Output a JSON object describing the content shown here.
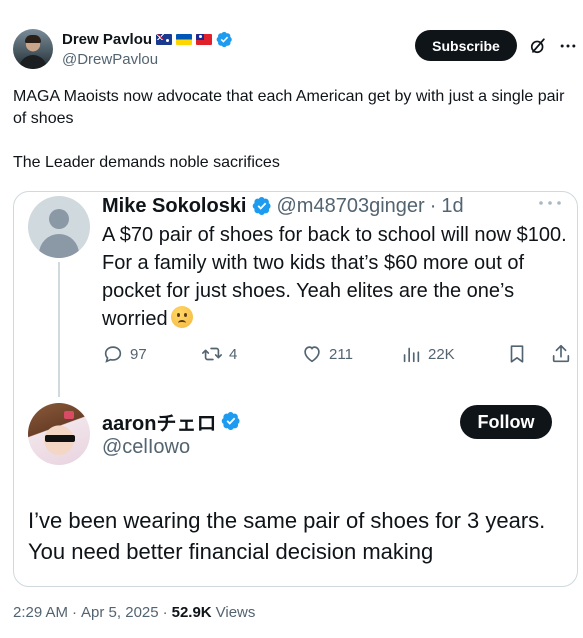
{
  "author": {
    "display_name": "Drew Pavlou",
    "handle": "@DrewPavlou",
    "flags": [
      "australia-flag",
      "ukraine-flag",
      "taiwan-flag"
    ],
    "verified": true
  },
  "header": {
    "subscribe_label": "Subscribe",
    "icons": [
      "grok-icon",
      "more-icon"
    ]
  },
  "post": {
    "line1": "MAGA Maoists now advocate that each American get by with just a single pair of shoes",
    "line2": "The Leader demands noble sacrifices"
  },
  "quote": {
    "original": {
      "display_name": "Mike Sokoloski",
      "handle": "@m48703ginger",
      "separator": "·",
      "time": "1d",
      "text": "A $70 pair of shoes for back to school will now $100. For a family with two kids that’s $60 more out of pocket for just shoes. Yeah elites are the one’s worried",
      "emoji": "worried-face-emoji",
      "stats": {
        "replies": "97",
        "reposts": "4",
        "likes": "211",
        "views": "22K"
      }
    },
    "reply": {
      "display_name": "aaronチェロ",
      "handle": "@celIowo",
      "follow_label": "Follow",
      "text": "I’ve been wearing the same pair of shoes for 3 years. You need better financial decision making"
    }
  },
  "footer": {
    "time": "2:29 AM",
    "sep1": "·",
    "date": "Apr 5, 2025",
    "sep2": "·",
    "views_count": "52.9K",
    "views_label": "Views"
  },
  "colors": {
    "text": "#0f1419",
    "secondary": "#536471",
    "border": "#cfd9de",
    "verified": "#1d9bf0",
    "button": "#0f1419"
  }
}
